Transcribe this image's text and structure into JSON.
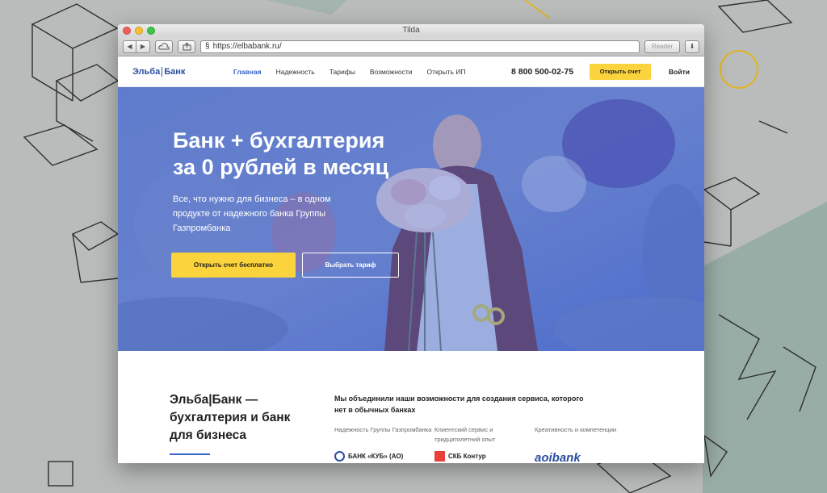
{
  "browser": {
    "window_title": "Tilda",
    "url": "https://elbabank.ru/",
    "reader_label": "Reader"
  },
  "header": {
    "logo_part1": "Эльба",
    "logo_part2": "Банк",
    "menu": [
      {
        "label": "Главная",
        "active": true
      },
      {
        "label": "Надежность",
        "active": false
      },
      {
        "label": "Тарифы",
        "active": false
      },
      {
        "label": "Возможности",
        "active": false
      },
      {
        "label": "Открыть ИП",
        "active": false
      }
    ],
    "phone": "8 800 500-02-75",
    "open_account_label": "Открыть счет",
    "login_label": "Войти"
  },
  "hero": {
    "title_line1": "Банк + бухгалтерия",
    "title_line2": "за 0 рублей в месяц",
    "subtitle": "Все, что нужно для бизнеса – в одном продукте от надежного банка Группы Газпромбанка",
    "primary_button": "Открыть счет бесплатно",
    "secondary_button": "Выбрать тариф"
  },
  "about": {
    "title": "Эльба|Банк — бухгалтерия и банк для бизнеса",
    "lead": "Мы объединили наши возможности для создания сервиса, которого нет в обычных банках",
    "features": [
      {
        "label": "Надежность Группы Газпромбанка",
        "logo_text": "БАНК «КУБ» (АО)"
      },
      {
        "label": "Клиентский сервис и тридцатилетний опыт",
        "logo_text": "СКБ Контур"
      },
      {
        "label": "Креативность и компетенции",
        "logo_text": "aoibank"
      }
    ]
  },
  "colors": {
    "accent_yellow": "#fbd33c",
    "brand_blue": "#2c4ea0",
    "hero_overlay": "#4a6ed7"
  }
}
